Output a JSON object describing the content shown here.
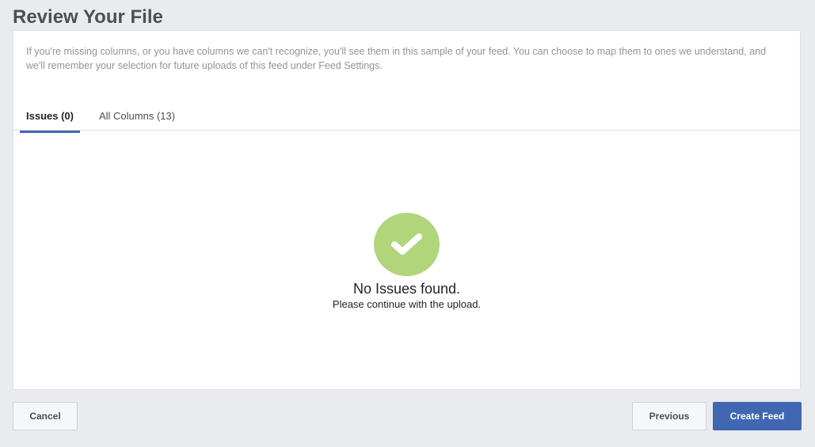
{
  "page": {
    "title": "Review Your File",
    "description": "If you're missing columns, or you have columns we can't recognize, you'll see them in this sample of your feed. You can choose to map them to ones we understand, and we'll remember your selection for future uploads of this feed under Feed Settings."
  },
  "tabs": [
    {
      "label": "Issues (0)",
      "active": true
    },
    {
      "label": "All Columns (13)",
      "active": false
    }
  ],
  "status": {
    "icon": "checkmark-icon",
    "title": "No Issues found.",
    "subtitle": "Please continue with the upload."
  },
  "footer": {
    "cancel_label": "Cancel",
    "previous_label": "Previous",
    "create_label": "Create Feed"
  },
  "colors": {
    "accent": "#4267b2",
    "success": "#b0d57b",
    "background": "#e9ebee"
  }
}
